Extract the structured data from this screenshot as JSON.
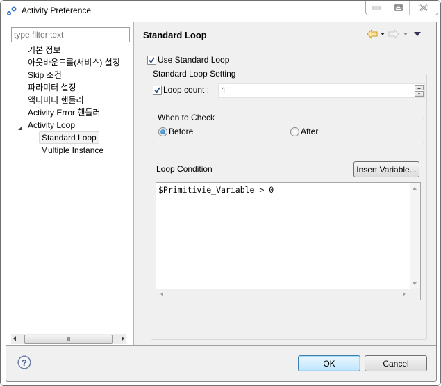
{
  "window": {
    "title": "Activity Preference",
    "controls": {
      "minimize": "minimize",
      "maximize": "maximize",
      "close": "close"
    }
  },
  "sidebar": {
    "filter_placeholder": "type filter text",
    "items": [
      {
        "label": "기본 정보",
        "level": 0
      },
      {
        "label": "아웃바운드룰(서비스) 설정",
        "level": 0
      },
      {
        "label": "Skip 조건",
        "level": 0
      },
      {
        "label": "파라미터 설정",
        "level": 0
      },
      {
        "label": "액티비티 핸들러",
        "level": 0
      },
      {
        "label": "Activity Error 핸들러",
        "level": 0
      },
      {
        "label": "Activity Loop",
        "level": 0,
        "expanded": true
      },
      {
        "label": "Standard Loop",
        "level": 1,
        "selected": true
      },
      {
        "label": "Multiple Instance",
        "level": 1
      }
    ],
    "scroll_thumb_label": "III"
  },
  "page": {
    "title": "Standard Loop",
    "nav": {
      "back": "back-arrow",
      "forward": "forward-arrow",
      "menu": "view-menu"
    },
    "use_standard_loop": {
      "label": "Use Standard Loop",
      "checked": true
    },
    "setting_group": {
      "title": "Standard Loop Setting",
      "loop_count": {
        "label": "Loop count :",
        "checked": true,
        "value": "1"
      },
      "when_to_check": {
        "title": "When to Check",
        "options": [
          {
            "label": "Before",
            "selected": true
          },
          {
            "label": "After",
            "selected": false
          }
        ]
      },
      "loop_condition": {
        "label": "Loop Condition",
        "insert_button": "Insert Variable...",
        "value": "$Primitivie_Variable > 0"
      }
    }
  },
  "footer": {
    "ok_label": "OK",
    "cancel_label": "Cancel"
  },
  "colors": {
    "dialog_bg": "#f0f0f0",
    "default_button_border": "#3c7fb1",
    "back_arrow": "#e8b84a"
  }
}
